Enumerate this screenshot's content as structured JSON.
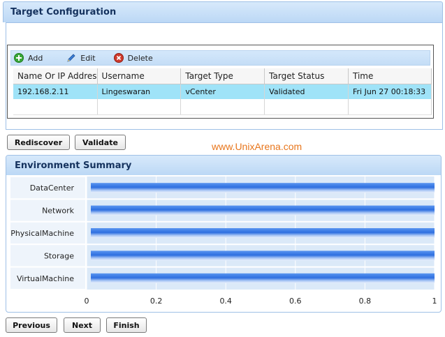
{
  "config_panel": {
    "title": "Target Configuration",
    "toolbar": {
      "add_label": "Add",
      "edit_label": "Edit",
      "delete_label": "Delete"
    },
    "table": {
      "columns": [
        "Name Or IP Addres",
        "Username",
        "Target Type",
        "Target Status",
        "Time"
      ],
      "rows": [
        [
          "192.168.2.11",
          "Lingeswaran",
          "vCenter",
          "Validated",
          "Fri Jun 27 00:18:33"
        ]
      ]
    }
  },
  "actions": {
    "rediscover_label": "Rediscover",
    "validate_label": "Validate"
  },
  "watermark": "www.UnixArena.com",
  "env_summary": {
    "title": "Environment Summary"
  },
  "chart_data": {
    "type": "bar",
    "orientation": "horizontal",
    "categories": [
      "DataCenter",
      "Network",
      "PhysicalMachine",
      "Storage",
      "VirtualMachine"
    ],
    "values": [
      1,
      1,
      1,
      1,
      1
    ],
    "xlim": [
      0,
      1
    ],
    "xticks": [
      "0",
      "0.2",
      "0.4",
      "0.6",
      "0.8",
      "1"
    ],
    "grid": true,
    "bar_color": "#2e6fe0"
  },
  "nav": {
    "previous_label": "Previous",
    "next_label": "Next",
    "finish_label": "Finish"
  },
  "colors": {
    "header_bg": "#c8e0f8",
    "selected_row": "#9fe3f8",
    "watermark": "#e8761c"
  }
}
